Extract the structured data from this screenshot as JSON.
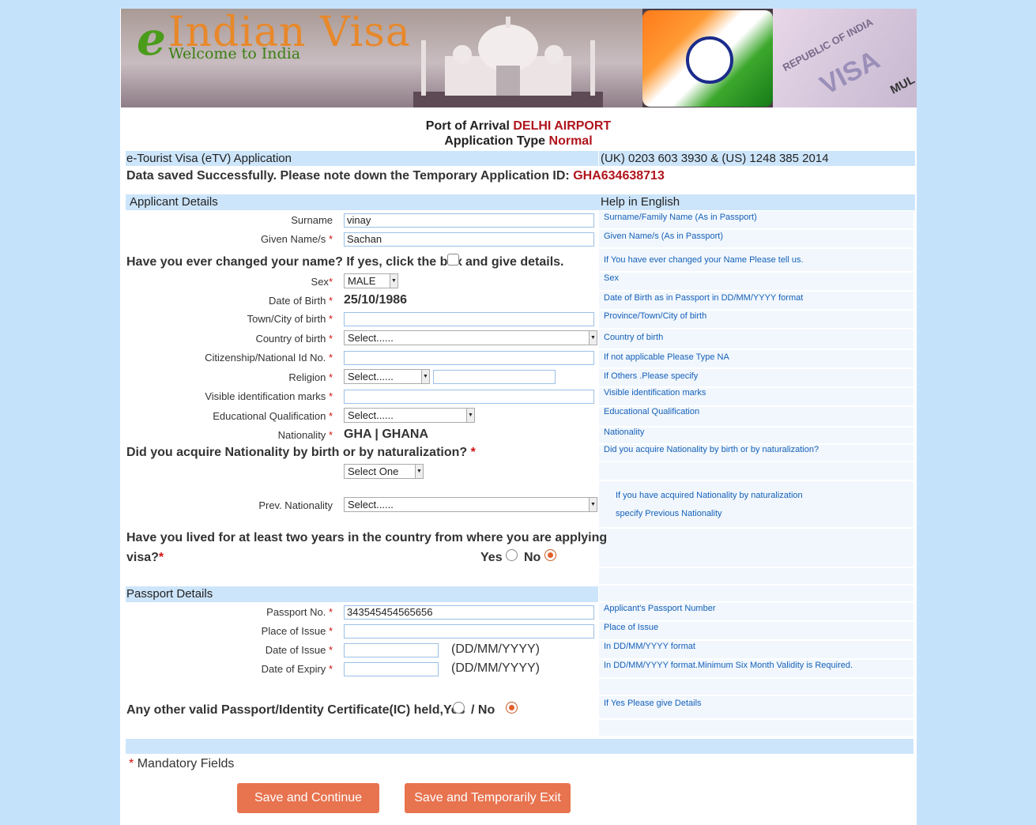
{
  "banner": {
    "logo_prefix": "e",
    "logo_title": "Indian Visa",
    "logo_subtitle": "Welcome to India",
    "visa_text_1": "REPUBLIC OF INDIA",
    "visa_text_2": "VISA",
    "visa_text_3": "MUL"
  },
  "arrival": {
    "port_label": "Port of Arrival",
    "port_value": "DELHI AIRPORT",
    "type_label": "Application Type",
    "type_value": "Normal"
  },
  "header_bar": {
    "title": "e-Tourist Visa (eTV) Application",
    "phones": "(UK) 0203 603 3930 & (US) 1248 385 2014"
  },
  "saved_msg": {
    "text": "Data saved Successfully. Please note down the Temporary Application ID:",
    "app_id": "GHA634638713"
  },
  "applicant": {
    "section_title": "Applicant Details",
    "help_title": "Help in English",
    "surname_label": "Surname",
    "surname_value": "vinay",
    "given_label": "Given Name/s",
    "given_value": "Sachan",
    "name_change_q1": "Have you ever changed your name? If yes, click the box",
    "name_change_q2": "and give details.",
    "sex_label": "Sex",
    "sex_value": "MALE",
    "dob_label": "Date of Birth",
    "dob_value": "25/10/1986",
    "town_label": "Town/City of birth",
    "country_label": "Country of birth",
    "country_value": "Select......",
    "natid_label": "Citizenship/National Id No.",
    "religion_label": "Religion",
    "religion_value": "Select......",
    "marks_label": "Visible identification marks",
    "edu_label": "Educational Qualification",
    "edu_value": "Select......",
    "nationality_label": "Nationality",
    "nationality_value": "GHA | GHANA",
    "acquire_q": "Did you acquire Nationality by birth or by naturalization?",
    "acquire_value": "Select One",
    "prev_nat_label": "Prev. Nationality",
    "prev_nat_value": "Select......",
    "lived_q1": "Have you lived for at least two years in the country from where you are applying",
    "lived_q2": "visa?",
    "yes": "Yes",
    "no": "No"
  },
  "help": {
    "surname": "Surname/Family Name (As in Passport)",
    "given": "Given Name/s (As in Passport)",
    "name_change": "If You have ever changed your Name Please tell us.",
    "sex": "Sex",
    "dob": "Date of Birth as in Passport in DD/MM/YYYY format",
    "town": "Province/Town/City of birth",
    "country": "Country of birth",
    "natid": "If not applicable Please Type NA",
    "religion": "If Others .Please specify",
    "marks": "Visible identification marks",
    "edu": "Educational Qualification",
    "nationality": "Nationality",
    "acquire": "Did you acquire Nationality by birth or by naturalization?",
    "prev1": "If you have acquired Nationality by naturalization",
    "prev2": "specify Previous Nationality",
    "passport_no": "Applicant's Passport Number",
    "place": "Place of Issue",
    "doi": "In DD/MM/YYYY format",
    "doe": "In DD/MM/YYYY format.Minimum Six Month Validity is Required.",
    "other": "If Yes Please give Details"
  },
  "passport": {
    "section_title": "Passport Details",
    "no_label": "Passport No.",
    "no_value": "343545454565656",
    "place_label": "Place of Issue",
    "doi_label": "Date of Issue",
    "doe_label": "Date of Expiry",
    "date_format": "(DD/MM/YYYY)",
    "other_q": "Any other valid Passport/Identity Certificate(IC) held,Yes",
    "other_no": "/ No"
  },
  "footer": {
    "mandatory": "Mandatory Fields",
    "save_continue": "Save and Continue",
    "save_exit": "Save and Temporarily Exit"
  },
  "colors": {
    "accent_red": "#b0141c",
    "button": "#e8734f",
    "bar": "#cde5fa",
    "help_text": "#1560b8"
  }
}
